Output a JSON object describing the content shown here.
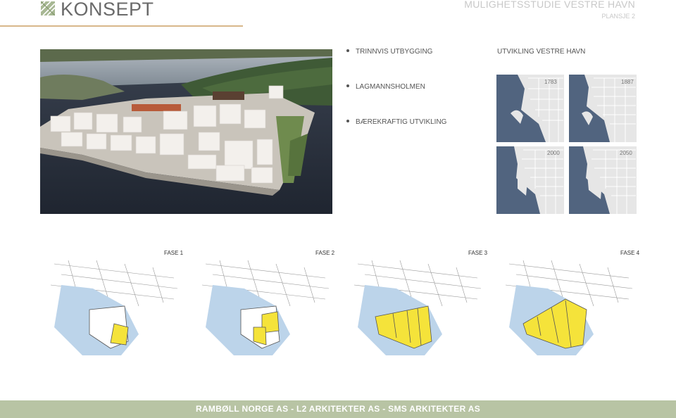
{
  "header": {
    "title": "KONSEPT",
    "project": "MULIGHETSSTUDIE VESTRE HAVN",
    "sheet": "PLANSJE 2"
  },
  "bullets": [
    {
      "label": "TRINNVIS UTBYGGING"
    },
    {
      "label": "LAGMANNSHOLMEN"
    },
    {
      "label": "BÆREKRAFTIG UTVIKLING"
    }
  ],
  "development": {
    "title": "UTVIKLING VESTRE HAVN",
    "years": [
      "1783",
      "1887",
      "2000",
      "2050"
    ]
  },
  "phases": [
    "FASE 1",
    "FASE 2",
    "FASE 3",
    "FASE 4"
  ],
  "footer": {
    "credits": "RAMBØLL NORGE AS - L2 ARKITEKTER AS - SMS ARKITEKTER AS"
  },
  "colors": {
    "accent_line": "#d8b78a",
    "footer_bg": "#b8c4a4",
    "map_water": "#51647f",
    "phase_yellow": "#f5e33a",
    "phase_water": "#bcd4ea"
  }
}
